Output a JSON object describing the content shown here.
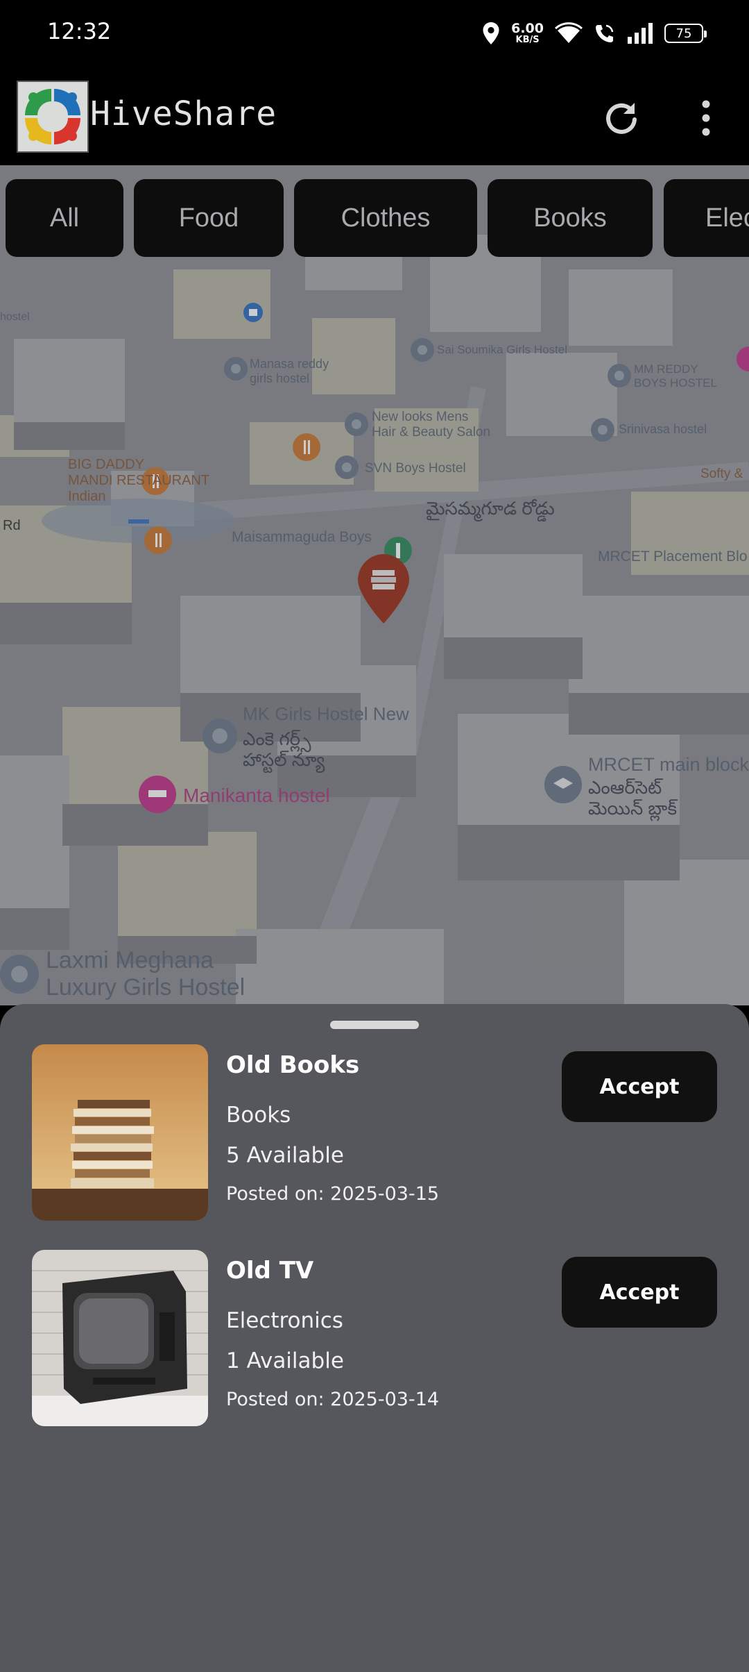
{
  "status_bar": {
    "time": "12:32",
    "network_speed_value": "6.00",
    "network_speed_unit": "KB/S",
    "battery_level": "75",
    "icons": [
      "location-icon",
      "wifi-icon",
      "wifi-call-icon",
      "signal-icon",
      "battery-icon"
    ]
  },
  "app_bar": {
    "title": "HiveShare",
    "actions": [
      "refresh-icon",
      "more-vert-icon"
    ]
  },
  "filter_chips": [
    "All",
    "Food",
    "Clothes",
    "Books",
    "Elec"
  ],
  "map": {
    "labels": {
      "mandi": "BIG DADDY\nMANDI RESTAURANT\nIndian",
      "rd": "Rd",
      "monika": "Manasa reddy\ngirls hostel",
      "saisoumika": "Sai Soumika Girls Hostel",
      "newlooks": "New looks Mens\nHair & Beauty Salon",
      "svn": "SVN Boys Hostel",
      "maisammaguda_boys": "Maisammaguda Boys",
      "telugu_road": "మైసమ్మగూడ రోడ్డు",
      "mmreddy": "MM REDDY\nBOYS HOSTEL",
      "srinivasa": "Srinivasa hostel",
      "softy": "Softy &",
      "mrcet_placement": "MRCET Placement Blo",
      "mk_girls": "MK Girls Hostel New",
      "mk_girls_te": "ఎంకె గర్ల్స్\nహాస్టల్ న్యూ",
      "manikanta": "Manikanta hostel",
      "mrcet_main": "MRCET main block",
      "mrcet_main_te": "ఎంఆర్‌సెట్\nమెయిన్ బ్లాక్",
      "laxmi": "Laxmi Meghana\nLuxury Girls Hostel",
      "hostel_left": "hostel"
    }
  },
  "sheet": {
    "items": [
      {
        "name": "Old Books",
        "category": "Books",
        "available": "5 Available",
        "posted": "Posted on: 2025-03-15",
        "action": "Accept"
      },
      {
        "name": "Old TV",
        "category": "Electronics",
        "available": "1 Available",
        "posted": "Posted on: 2025-03-14",
        "action": "Accept"
      }
    ]
  },
  "colors": {
    "sheet_bg": "#56575c",
    "button_bg": "#111111",
    "marker_red": "#9a2f17",
    "hotel_pink": "#c2338a",
    "food_orange": "#d77a2d"
  }
}
